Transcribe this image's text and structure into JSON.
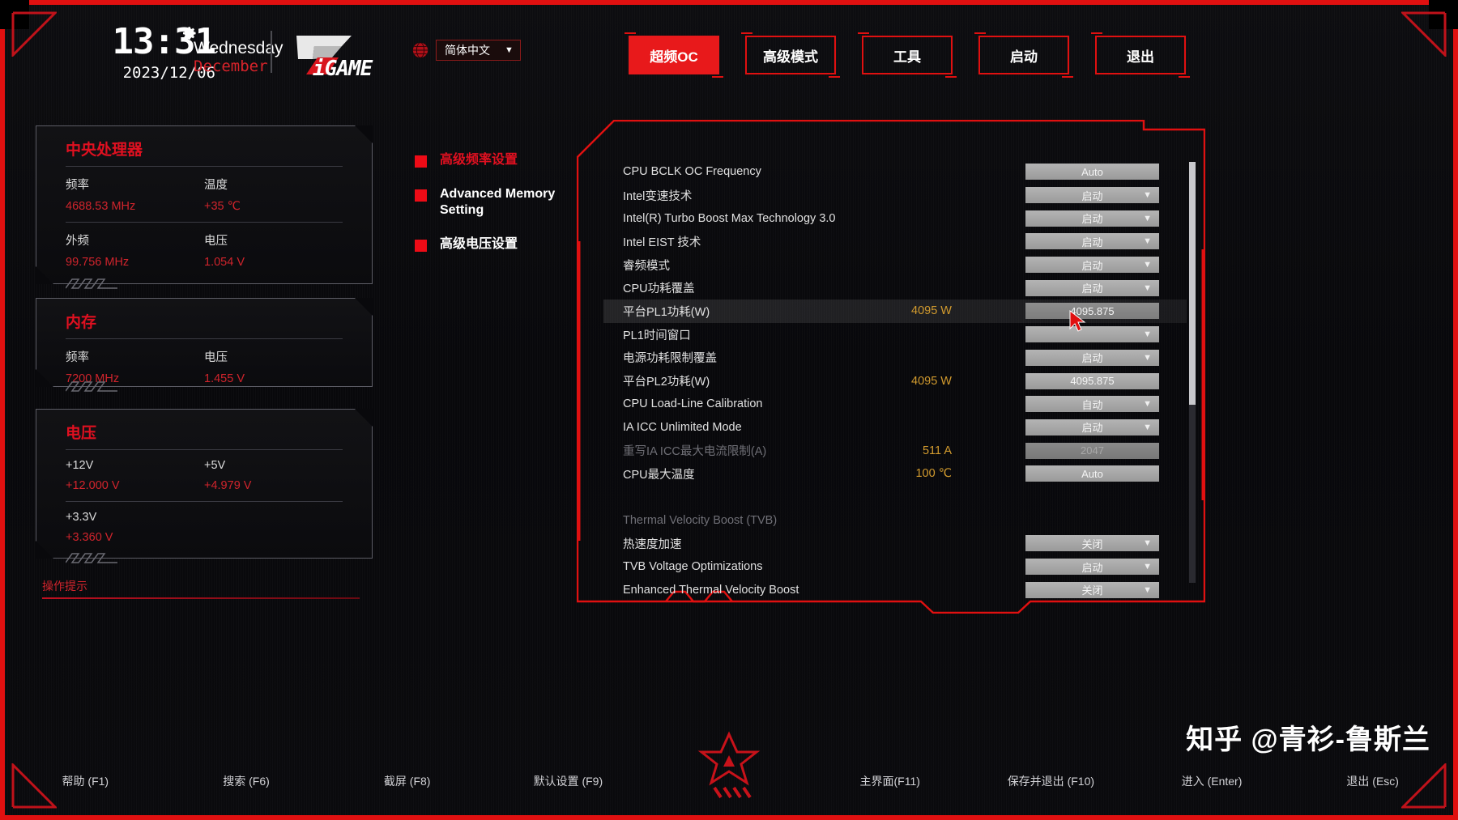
{
  "header": {
    "time": "13:31",
    "date": "2023/12/06",
    "weekday": "Wednesday",
    "month": "December",
    "gear_icon": "gear-icon",
    "brand": "iGAME",
    "language": {
      "icon": "globe-icon",
      "value": "简体中文",
      "caret": "▼"
    },
    "nav": [
      {
        "label": "超频OC",
        "active": true
      },
      {
        "label": "高级模式",
        "active": false
      },
      {
        "label": "工具",
        "active": false
      },
      {
        "label": "启动",
        "active": false
      },
      {
        "label": "退出",
        "active": false
      }
    ]
  },
  "sidebar": {
    "panels": [
      {
        "title": "中央处理器",
        "rows": [
          [
            {
              "label": "频率",
              "value": "4688.53 MHz"
            },
            {
              "label": "温度",
              "value": "+35 ℃"
            }
          ],
          [
            {
              "label": "外频",
              "value": "99.756 MHz"
            },
            {
              "label": "电压",
              "value": "1.054 V"
            }
          ]
        ]
      },
      {
        "title": "内存",
        "rows": [
          [
            {
              "label": "频率",
              "value": "7200 MHz"
            },
            {
              "label": "电压",
              "value": "1.455 V"
            }
          ]
        ]
      },
      {
        "title": "电压",
        "rows": [
          [
            {
              "label": "+12V",
              "value": "+12.000 V"
            },
            {
              "label": "+5V",
              "value": "+4.979 V"
            }
          ],
          [
            {
              "label": "+3.3V",
              "value": "+3.360 V"
            },
            {
              "label": "",
              "value": ""
            }
          ]
        ]
      }
    ],
    "operation_tip": "操作提示"
  },
  "midmenu": [
    {
      "label": "高级频率设置",
      "selected": true
    },
    {
      "label": "Advanced Memory Setting",
      "selected": false
    },
    {
      "label": "高级电压设置",
      "selected": false
    }
  ],
  "settings": {
    "rows": [
      {
        "name": "CPU BCLK OC Frequency",
        "mid": "",
        "control": "Auto",
        "type": "text",
        "selected": false,
        "dim": false
      },
      {
        "name": "Intel变速技术",
        "mid": "",
        "control": "启动",
        "type": "dropdown",
        "selected": false,
        "dim": false
      },
      {
        "name": "Intel(R) Turbo Boost Max Technology 3.0",
        "mid": "",
        "control": "启动",
        "type": "dropdown",
        "selected": false,
        "dim": false
      },
      {
        "name": "Intel EIST 技术",
        "mid": "",
        "control": "启动",
        "type": "dropdown",
        "selected": false,
        "dim": false
      },
      {
        "name": "睿频模式",
        "mid": "",
        "control": "启动",
        "type": "dropdown",
        "selected": false,
        "dim": false
      },
      {
        "name": "CPU功耗覆盖",
        "mid": "",
        "control": "启动",
        "type": "dropdown",
        "selected": false,
        "dim": false
      },
      {
        "name": "平台PL1功耗(W)",
        "mid": "4095 W",
        "control": "4095.875",
        "type": "text",
        "selected": true,
        "dim": false
      },
      {
        "name": "PL1时间窗口",
        "mid": "",
        "control": "",
        "type": "dropdown",
        "selected": false,
        "dim": false
      },
      {
        "name": "电源功耗限制覆盖",
        "mid": "",
        "control": "启动",
        "type": "dropdown",
        "selected": false,
        "dim": false
      },
      {
        "name": "平台PL2功耗(W)",
        "mid": "4095 W",
        "control": "4095.875",
        "type": "text",
        "selected": false,
        "dim": false
      },
      {
        "name": "CPU Load-Line Calibration",
        "mid": "",
        "control": "自动",
        "type": "dropdown",
        "selected": false,
        "dim": false
      },
      {
        "name": "IA ICC Unlimited Mode",
        "mid": "",
        "control": "启动",
        "type": "dropdown",
        "selected": false,
        "dim": false
      },
      {
        "name": "重写IA ICC最大电流限制(A)",
        "mid": "511 A",
        "control": "2047",
        "type": "text",
        "selected": false,
        "dim": true
      },
      {
        "name": "CPU最大温度",
        "mid": "100 ℃",
        "control": "Auto",
        "type": "text",
        "selected": false,
        "dim": false
      },
      {
        "name": "",
        "mid": "",
        "control": "",
        "type": "blank",
        "selected": false,
        "dim": false
      },
      {
        "name": "Thermal Velocity Boost (TVB)",
        "mid": "",
        "control": "",
        "type": "blank",
        "selected": false,
        "dim": true
      },
      {
        "name": "热速度加速",
        "mid": "",
        "control": "关闭",
        "type": "dropdown",
        "selected": false,
        "dim": false
      },
      {
        "name": "TVB Voltage Optimizations",
        "mid": "",
        "control": "启动",
        "type": "dropdown",
        "selected": false,
        "dim": false
      },
      {
        "name": "Enhanced Thermal Velocity Boost",
        "mid": "",
        "control": "关闭",
        "type": "dropdown",
        "selected": false,
        "dim": false
      }
    ],
    "caret": "▼"
  },
  "footer": {
    "keys": [
      "帮助 (F1)",
      "搜索 (F6)",
      "截屏 (F8)",
      "默认设置 (F9)",
      "",
      "主界面(F11)",
      "保存并退出 (F10)",
      "进入 (Enter)",
      "退出 (Esc)"
    ]
  },
  "watermark": "知乎 @青衫-鲁斯兰",
  "colors": {
    "accent_red": "#e01010",
    "value_red": "#d0242c",
    "mid_value": "#d19a2e",
    "panel_border": "#5d5d66"
  }
}
